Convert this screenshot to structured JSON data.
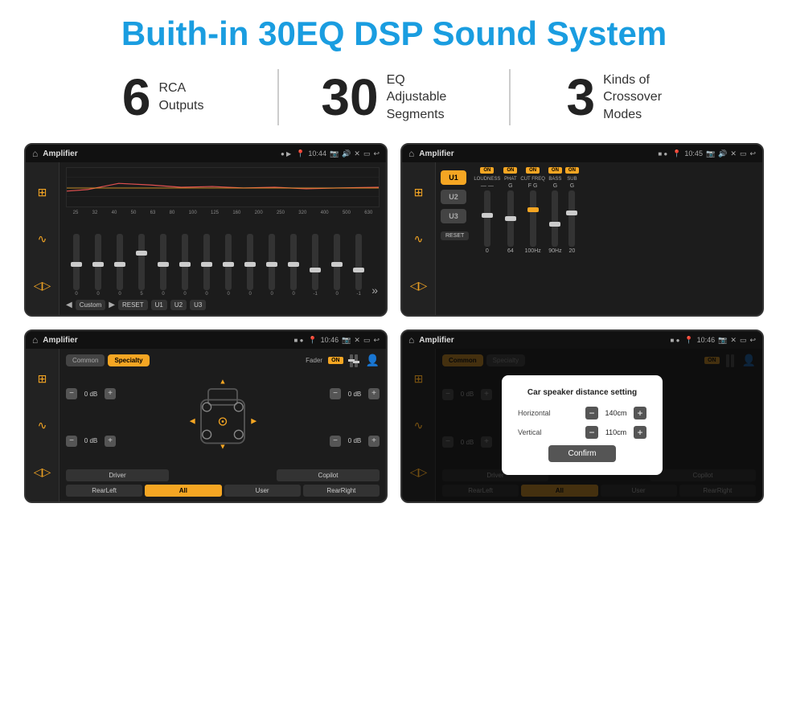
{
  "header": {
    "title": "Buith-in 30EQ DSP Sound System"
  },
  "stats": [
    {
      "number": "6",
      "desc_line1": "RCA",
      "desc_line2": "Outputs"
    },
    {
      "number": "30",
      "desc_line1": "EQ Adjustable",
      "desc_line2": "Segments"
    },
    {
      "number": "3",
      "desc_line1": "Kinds of",
      "desc_line2": "Crossover Modes"
    }
  ],
  "screens": [
    {
      "id": "eq-screen",
      "statusbar": {
        "icon": "🏠",
        "title": "Amplifier",
        "time": "10:44"
      },
      "type": "eq",
      "eq_freqs": [
        "25",
        "32",
        "40",
        "50",
        "63",
        "80",
        "100",
        "125",
        "160",
        "200",
        "250",
        "320",
        "400",
        "500",
        "630"
      ],
      "eq_values": [
        "0",
        "0",
        "0",
        "5",
        "0",
        "0",
        "0",
        "0",
        "0",
        "0",
        "0",
        "-1",
        "0",
        "-1"
      ],
      "eq_presets": [
        "Custom",
        "RESET",
        "U1",
        "U2",
        "U3"
      ]
    },
    {
      "id": "crossover-screen",
      "statusbar": {
        "icon": "🏠",
        "title": "Amplifier",
        "time": "10:45"
      },
      "type": "crossover",
      "presets": [
        "U1",
        "U2",
        "U3"
      ],
      "channels": [
        "LOUDNESS",
        "PHAT",
        "CUT FREQ",
        "BASS",
        "SUB"
      ],
      "channel_states": [
        "ON",
        "ON",
        "ON",
        "ON",
        "ON"
      ]
    },
    {
      "id": "fader-screen",
      "statusbar": {
        "icon": "🏠",
        "title": "Amplifier",
        "time": "10:46"
      },
      "type": "fader",
      "tabs": [
        "Common",
        "Specialty"
      ],
      "active_tab": "Specialty",
      "fader_label": "Fader",
      "fader_on": "ON",
      "db_values": [
        "0 dB",
        "0 dB",
        "0 dB",
        "0 dB"
      ],
      "bottom_btns": [
        "Driver",
        "",
        "Copilot",
        "RearLeft",
        "All",
        "User",
        "RearRight"
      ]
    },
    {
      "id": "dialog-screen",
      "statusbar": {
        "icon": "🏠",
        "title": "Amplifier",
        "time": "10:46"
      },
      "type": "dialog",
      "dialog": {
        "title": "Car speaker distance setting",
        "fields": [
          {
            "label": "Horizontal",
            "value": "140cm"
          },
          {
            "label": "Vertical",
            "value": "110cm"
          }
        ],
        "confirm_label": "Confirm"
      },
      "tabs": [
        "Common",
        "Specialty"
      ],
      "active_tab": "Common",
      "db_values": [
        "0 dB",
        "0 dB"
      ]
    }
  ]
}
